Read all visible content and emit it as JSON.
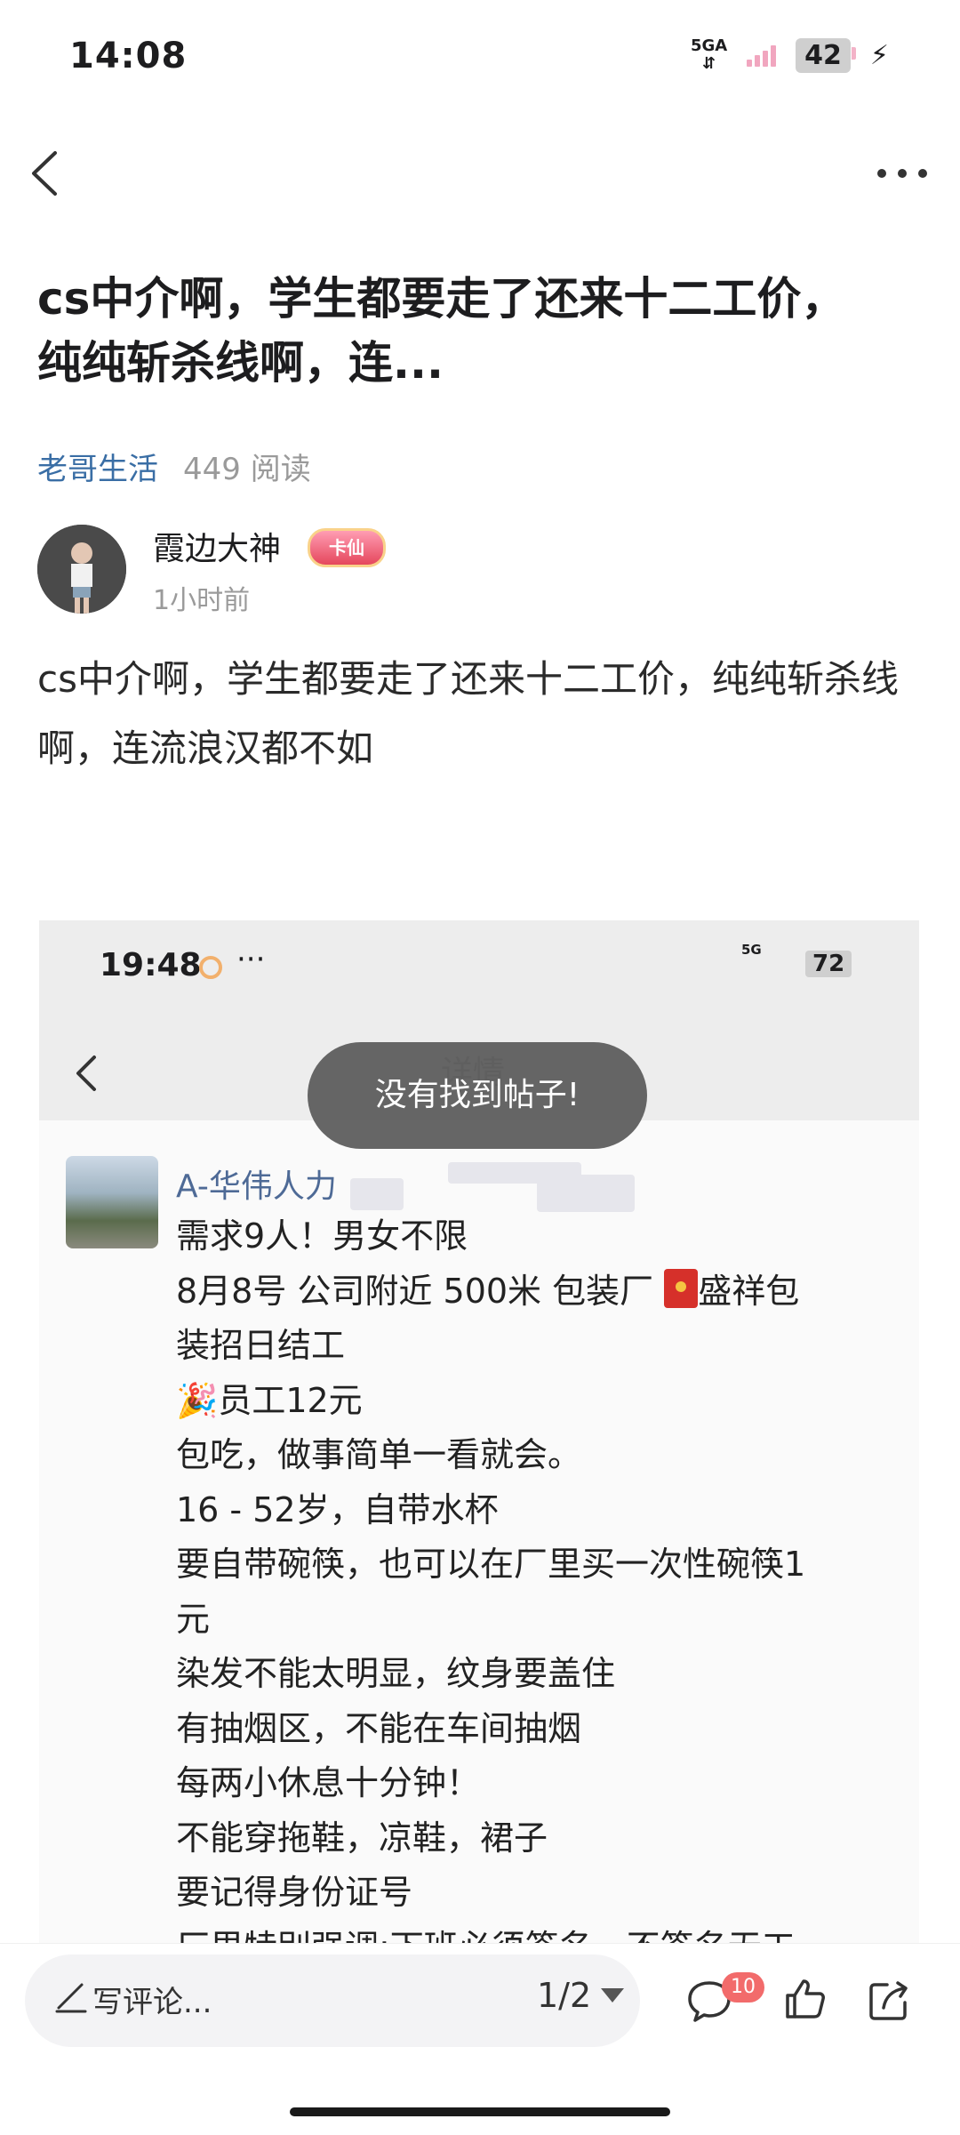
{
  "status_bar": {
    "time": "14:08",
    "network": "5GA",
    "battery": "42"
  },
  "post": {
    "title": "cs中介啊，学生都要走了还来十二工价，纯纯斩杀线啊，连...",
    "category": "老哥生活",
    "read_count": "449 阅读",
    "author": {
      "name": "霞边大神",
      "badge": "卡仙",
      "time": "1小时前"
    },
    "body": "cs中介啊，学生都要走了还来十二工价，纯纯斩杀线啊，连流浪汉都不如"
  },
  "embedded_screenshot": {
    "time": "19:48",
    "dots": "···",
    "network": "5G",
    "battery": "72",
    "title": "详情",
    "username": "A-华伟人力",
    "lines": [
      "需求9人！男女不限",
      "8月8号 公司附近 500米 包装厂",
      "盛祥包",
      "装招日结工",
      "员工12元",
      "包吃，做事简单一看就会。",
      "16 - 52岁，自带水杯",
      "要自带碗筷，也可以在厂里买一次性碗筷1",
      "元",
      "染发不能太明显，纹身要盖住",
      "有抽烟区，不能在车间抽烟",
      "每两小休息十分钟！",
      "不能穿拖鞋，凉鞋，裙子",
      "要记得身份证号",
      "厂里特别强调:下班必须签名，不签名无工"
    ]
  },
  "toast": "没有找到帖子!",
  "bottom_bar": {
    "comment_placeholder": "写评论...",
    "page_indicator": "1/2",
    "comment_count": "10"
  }
}
